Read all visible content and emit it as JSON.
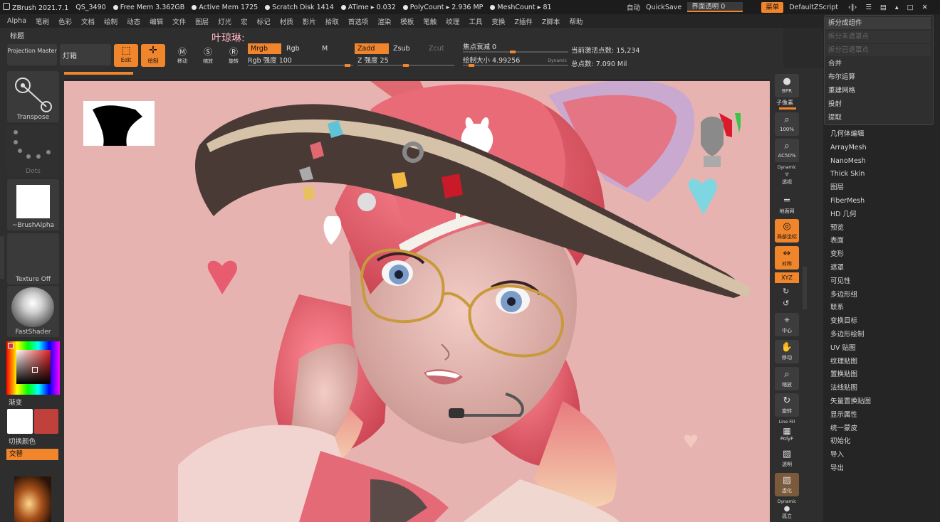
{
  "statusbar": {
    "app": "ZBrush 2021.7.1",
    "doc": "QS_3490",
    "free_mem": "Free Mem 3.362GB",
    "active_mem": "Active Mem 1725",
    "scratch": "Scratch Disk 1414",
    "atime": "ATime ▸ 0.032",
    "polycount": "PolyCount ▸ 2.936 MP",
    "meshcount": "MeshCount ▸ 81"
  },
  "topright": {
    "auto": "自动",
    "quicksave": "QuickSave",
    "transparency": "界面透明 0",
    "menu": "菜单",
    "script": "DefaultZScript"
  },
  "menubar": [
    "Alpha",
    "笔刷",
    "色彩",
    "文档",
    "绘制",
    "动态",
    "编辑",
    "文件",
    "图层",
    "灯光",
    "宏",
    "标记",
    "材质",
    "影片",
    "拾取",
    "首选项",
    "渲染",
    "模板",
    "笔触",
    "纹理",
    "工具",
    "变换",
    "Z插件",
    "Z脚本",
    "帮助"
  ],
  "toolbar": {
    "title": "标题",
    "overlay_name": "叶琼琳:",
    "projection_master": "Projection Master",
    "lightbox": "灯箱",
    "edit": "Edit",
    "draw": "绘制",
    "move": "移动",
    "scale": "缩放",
    "rotate": "旋转",
    "mrgb": "Mrgb",
    "rgb": "Rgb",
    "m": "M",
    "zadd": "Zadd",
    "zsub": "Zsub",
    "zcut": "Zcut",
    "rgb_intensity": "Rgb 强度 100",
    "z_intensity": "Z 强度 25",
    "focal_shift": "焦点衰减 0",
    "draw_size": "绘制大小 4.99256",
    "dynamic": "Dynamic",
    "active_points": "当前激活点数: 15,234",
    "total_points": "总点数: 7.090 Mil"
  },
  "leftpanel": {
    "transpose": "Transpose",
    "dots": "Dots",
    "brush_alpha": "~BrushAlpha",
    "texture": "Texture Off",
    "fastshader": "FastShader",
    "gradient": "渐变",
    "switch_color": "切换颜色",
    "alternate": "交替",
    "main_color": "#ffffff",
    "secondary_color": "#c0403c"
  },
  "rightshelf": {
    "bpr": "BPR",
    "subpixel": "子像素",
    "zoom": "100%",
    "ac": "AC50%",
    "dynamic": "Dynamic",
    "persp": "透视",
    "floor": "地面网",
    "local": "局部坐标",
    "sym": "对称",
    "xyz": "XYZ",
    "center": "中心",
    "move": "移动",
    "scale": "缩放",
    "rotate": "旋转",
    "line_fill": "Line Fill",
    "polyf": "PolyF",
    "transp": "透明",
    "ghost": "虚化",
    "solo": "孤立"
  },
  "popup": {
    "items": [
      {
        "label": "拆分成组件",
        "state": "hi"
      },
      {
        "label": "拆分未遮罩点",
        "state": "dim"
      },
      {
        "label": "拆分已遮罩点",
        "state": "dim"
      },
      {
        "label": "合并",
        "state": "normal"
      },
      {
        "label": "布尔运算",
        "state": "normal"
      },
      {
        "label": "重建网格",
        "state": "normal"
      },
      {
        "label": "投射",
        "state": "normal"
      },
      {
        "label": "提取",
        "state": "normal"
      }
    ]
  },
  "submenu": [
    "几何体编辑",
    "ArrayMesh",
    "NanoMesh",
    "Thick Skin",
    "图层",
    "FiberMesh",
    "HD 几何",
    "预览",
    "表面",
    "变形",
    "遮罩",
    "可见性",
    "多边形组",
    "联系",
    "变换目标",
    "多边形绘制",
    "UV 贴图",
    "纹理贴图",
    "置换贴图",
    "法线贴图",
    "矢量置换贴图",
    "显示属性",
    "统一蒙皮",
    "初始化",
    "导入",
    "导出"
  ],
  "colors": {
    "accent": "#f0852c",
    "canvas_bg": "#e7b3b1",
    "hair": "#e8606e",
    "hat": "#4a3a36"
  }
}
